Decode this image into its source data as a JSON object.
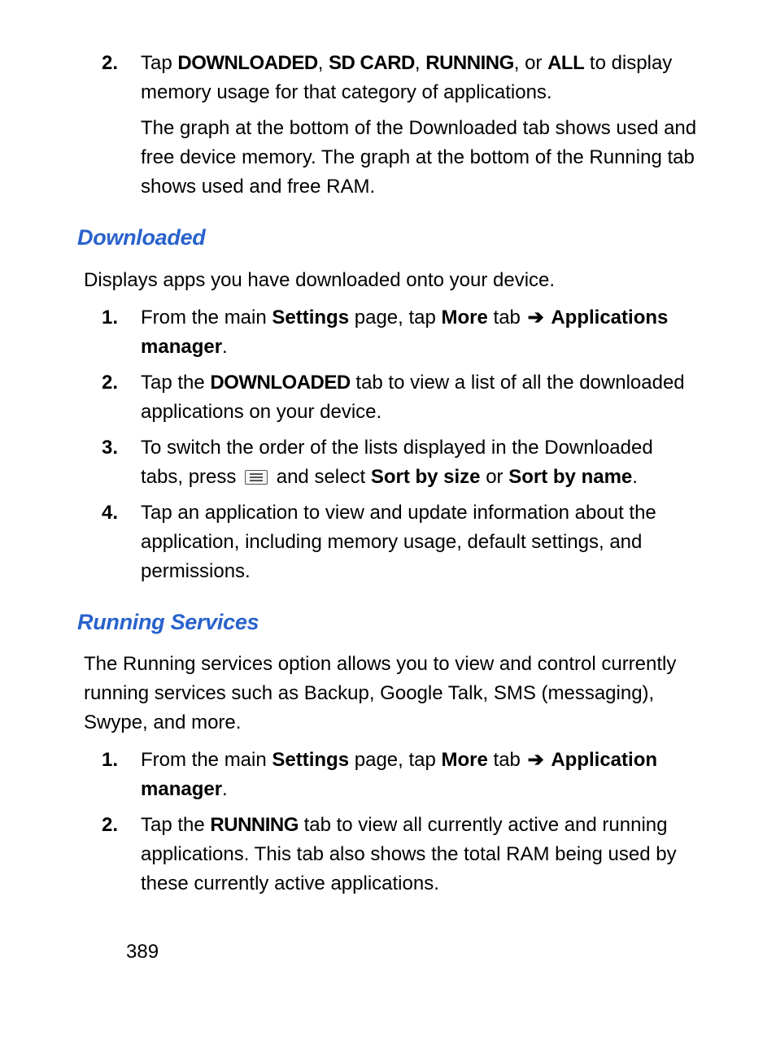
{
  "intro_step": {
    "num": "2.",
    "line1_pre": "Tap ",
    "t1": "DOWNLOADED",
    "c1": ", ",
    "t2": "SD CARD",
    "c2": ", ",
    "t3": "RUNNING",
    "c3": ", or ",
    "t4": "ALL",
    "line1_post": " to display memory usage for that category of applications.",
    "para2": "The graph at the bottom of the Downloaded tab shows used and free device memory. The graph at the bottom of the Running tab shows used and free RAM."
  },
  "downloaded": {
    "heading": "Downloaded",
    "intro": "Displays apps you have downloaded onto your device.",
    "steps": {
      "s1": {
        "num": "1.",
        "pre": "From the main ",
        "b1": "Settings",
        "mid1": " page, tap ",
        "b2": "More",
        "mid2": " tab ",
        "arrow": "➔",
        "mid3": " ",
        "b3": "Applications manager",
        "post": "."
      },
      "s2": {
        "num": "2.",
        "pre": "Tap the ",
        "b1": "DOWNLOADED",
        "post": " tab to view a list of all the downloaded applications on your device."
      },
      "s3": {
        "num": "3.",
        "pre": "To switch the order of the lists displayed in the Downloaded tabs, press ",
        "mid": " and select ",
        "b1": "Sort by size",
        "mid2": " or ",
        "b2": "Sort by name",
        "post": "."
      },
      "s4": {
        "num": "4.",
        "text": "Tap an application to view and update information about the application, including memory usage, default settings, and permissions."
      }
    }
  },
  "running": {
    "heading": "Running Services",
    "intro": "The Running services option allows you to view and control currently running services such as Backup, Google Talk, SMS (messaging), Swype, and more.",
    "steps": {
      "s1": {
        "num": "1.",
        "pre": "From the main ",
        "b1": "Settings",
        "mid1": " page, tap ",
        "b2": "More",
        "mid2": " tab ",
        "arrow": "➔",
        "mid3": " ",
        "b3": "Application manager",
        "post": "."
      },
      "s2": {
        "num": "2.",
        "pre": "Tap the ",
        "b1": "RUNNING",
        "post": " tab to view all currently active and running applications. This tab also shows the total RAM being used by these currently active applications."
      }
    }
  },
  "page_number": "389"
}
